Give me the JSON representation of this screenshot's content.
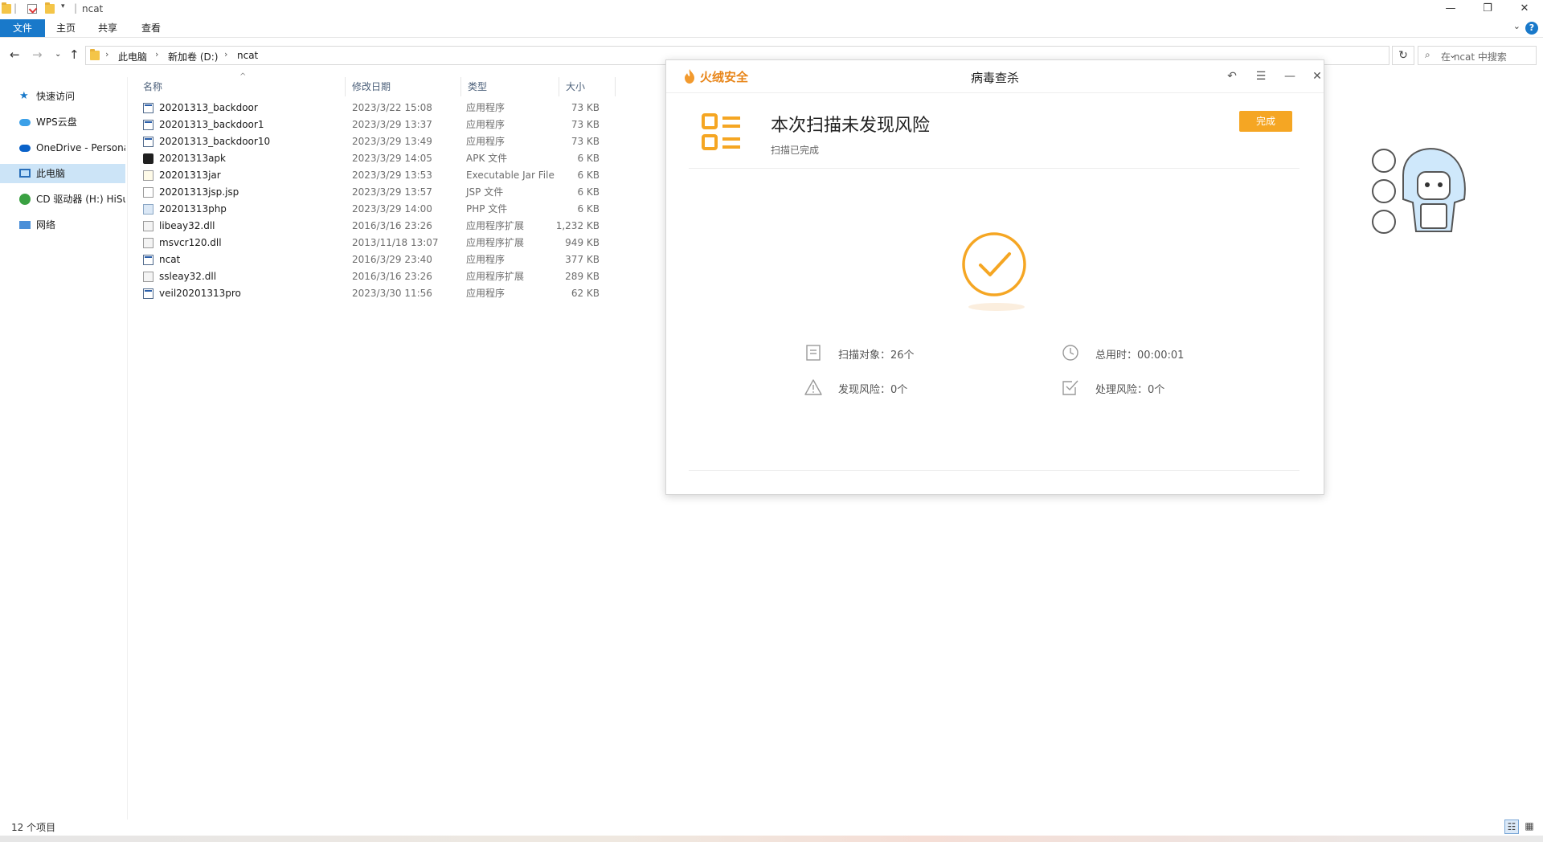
{
  "window": {
    "title": "ncat"
  },
  "ribbon": {
    "tabs": [
      "文件",
      "主页",
      "共享",
      "查看"
    ],
    "help": "?"
  },
  "address": {
    "crumbs": [
      "此电脑",
      "新加卷 (D:)",
      "ncat"
    ],
    "search_placeholder": "在 ncat 中搜索"
  },
  "nav": {
    "items": [
      "快速访问",
      "WPS云盘",
      "OneDrive - Persona",
      "此电脑",
      "CD 驱动器 (H:) HiSu",
      "网络"
    ]
  },
  "filelist": {
    "columns": [
      "名称",
      "修改日期",
      "类型",
      "大小"
    ],
    "rows": [
      {
        "name": "20201313_backdoor",
        "date": "2023/3/22 15:08",
        "type": "应用程序",
        "size": "73 KB",
        "icon": "exe"
      },
      {
        "name": "20201313_backdoor1",
        "date": "2023/3/29 13:37",
        "type": "应用程序",
        "size": "73 KB",
        "icon": "exe"
      },
      {
        "name": "20201313_backdoor10",
        "date": "2023/3/29 13:49",
        "type": "应用程序",
        "size": "73 KB",
        "icon": "exe"
      },
      {
        "name": "20201313apk",
        "date": "2023/3/29 14:05",
        "type": "APK 文件",
        "size": "6 KB",
        "icon": "apk"
      },
      {
        "name": "20201313jar",
        "date": "2023/3/29 13:53",
        "type": "Executable Jar File",
        "size": "6 KB",
        "icon": "jar"
      },
      {
        "name": "20201313jsp.jsp",
        "date": "2023/3/29 13:57",
        "type": "JSP 文件",
        "size": "6 KB",
        "icon": "doc"
      },
      {
        "name": "20201313php",
        "date": "2023/3/29 14:00",
        "type": "PHP 文件",
        "size": "6 KB",
        "icon": "php"
      },
      {
        "name": "libeay32.dll",
        "date": "2016/3/16 23:26",
        "type": "应用程序扩展",
        "size": "1,232 KB",
        "icon": "dll"
      },
      {
        "name": "msvcr120.dll",
        "date": "2013/11/18 13:07",
        "type": "应用程序扩展",
        "size": "949 KB",
        "icon": "dll"
      },
      {
        "name": "ncat",
        "date": "2016/3/29 23:40",
        "type": "应用程序",
        "size": "377 KB",
        "icon": "exe"
      },
      {
        "name": "ssleay32.dll",
        "date": "2016/3/16 23:26",
        "type": "应用程序扩展",
        "size": "289 KB",
        "icon": "dll"
      },
      {
        "name": "veil20201313pro",
        "date": "2023/3/30 11:56",
        "type": "应用程序",
        "size": "62 KB",
        "icon": "exe"
      }
    ]
  },
  "status": {
    "count": "12 个项目"
  },
  "dialog": {
    "brand": "火绒安全",
    "title": "病毒查杀",
    "result_title": "本次扫描未发现风险",
    "result_sub": "扫描已完成",
    "done_label": "完成",
    "stats": {
      "scanned": "扫描对象：26个",
      "elapsed": "总用时：00:00:01",
      "found": "发现风险：0个",
      "handled": "处理风险：0个"
    },
    "accent": "#f5a623"
  }
}
